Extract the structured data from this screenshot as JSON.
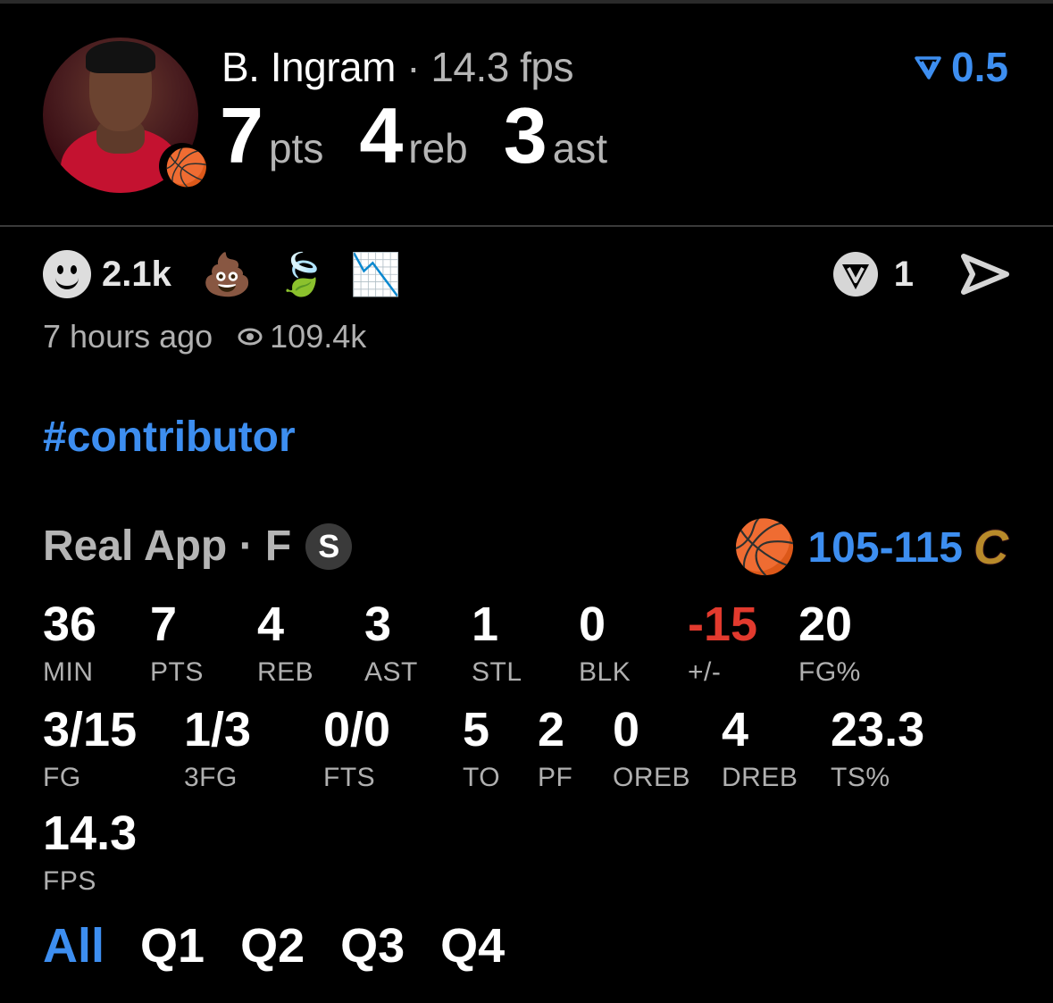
{
  "player": {
    "name": "B. Ingram",
    "separator": " · ",
    "fps": "14.3 fps",
    "points": "7",
    "points_label": "pts",
    "rebounds": "4",
    "rebounds_label": "reb",
    "assists": "3",
    "assists_label": "ast"
  },
  "top_score": {
    "value": "0.5",
    "icon": "vote-arrow-icon"
  },
  "reactions": {
    "smile_count": "2.1k",
    "emojis": [
      "💩",
      "🍃",
      "📉"
    ],
    "vote_count": "1"
  },
  "meta": {
    "time": "7 hours ago",
    "views": "109.4k"
  },
  "hashtag": "#contributor",
  "game": {
    "source": "Real App · F",
    "badge": "S",
    "score": "105-115"
  },
  "stats_row1": [
    {
      "value": "36",
      "label": "MIN"
    },
    {
      "value": "7",
      "label": "PTS"
    },
    {
      "value": "4",
      "label": "REB"
    },
    {
      "value": "3",
      "label": "AST"
    },
    {
      "value": "1",
      "label": "STL"
    },
    {
      "value": "0",
      "label": "BLK"
    },
    {
      "value": "-15",
      "label": "+/-"
    },
    {
      "value": "20",
      "label": "FG%"
    }
  ],
  "stats_row2": [
    {
      "value": "3/15",
      "label": "FG"
    },
    {
      "value": "1/3",
      "label": "3FG"
    },
    {
      "value": "0/0",
      "label": "FTS"
    },
    {
      "value": "5",
      "label": "TO"
    },
    {
      "value": "2",
      "label": "PF"
    },
    {
      "value": "0",
      "label": "OREB"
    },
    {
      "value": "4",
      "label": "DREB"
    },
    {
      "value": "23.3",
      "label": "TS%"
    }
  ],
  "stats_row3": [
    {
      "value": "14.3",
      "label": "FPS"
    }
  ],
  "quarters": [
    "All",
    "Q1",
    "Q2",
    "Q3",
    "Q4"
  ],
  "colors": {
    "accent": "#3d8ef0",
    "negative": "#e23a2e",
    "raptors": "#ce1141"
  }
}
